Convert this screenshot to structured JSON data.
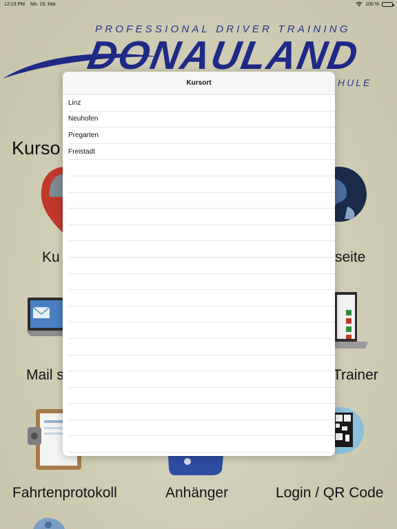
{
  "status_bar": {
    "time": "12:13 PM",
    "date": "Mo. 15. Mai",
    "battery": "100 %",
    "icons": [
      "wifi-icon",
      "battery-icon"
    ]
  },
  "logo": {
    "tagline": "PROFESSIONAL DRIVER TRAINING",
    "wordmark": "DONAULAND",
    "sub": "HULE"
  },
  "main": {
    "section_title": "Kurso",
    "tiles_row1": {
      "left": "Ku",
      "right": "seite"
    },
    "tiles_row2": {
      "left": "Mail s",
      "right": "Trainer"
    },
    "tiles_row3": {
      "left": "Fahrtenprotokoll",
      "center": "Anhänger",
      "right": "Login / QR Code"
    }
  },
  "modal": {
    "title": "Kursort",
    "options": [
      "Linz",
      "Neuhofen",
      "Pregarten",
      "Freistadt"
    ],
    "empty_rows": 18
  },
  "colors": {
    "brand_blue": "#1f2a86",
    "background": "#d3d0b9"
  }
}
